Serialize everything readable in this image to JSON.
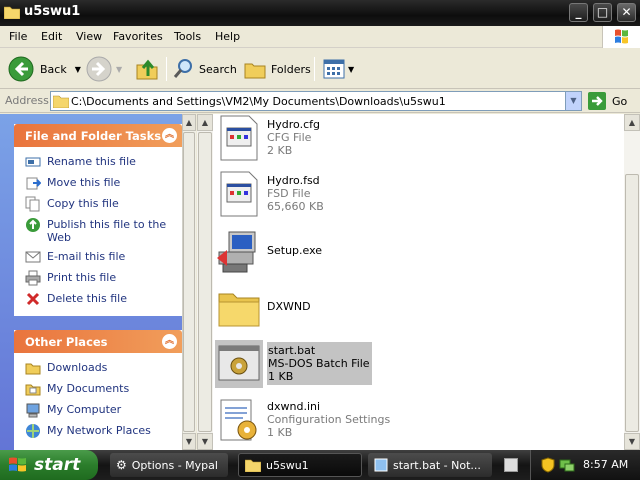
{
  "window": {
    "title": "u5swu1",
    "controls": {
      "minimize": "_",
      "maximize": "□",
      "close": "✕"
    }
  },
  "menu": [
    "File",
    "Edit",
    "View",
    "Favorites",
    "Tools",
    "Help"
  ],
  "toolbar": {
    "back": "Back",
    "search": "Search",
    "folders": "Folders"
  },
  "address": {
    "label": "Address",
    "path": "C:\\Documents and Settings\\VM2\\My Documents\\Downloads\\u5swu1",
    "go": "Go"
  },
  "left": {
    "file_tasks": {
      "title": "File and Folder Tasks",
      "items": [
        "Rename this file",
        "Move this file",
        "Copy this file",
        "Publish this file to the Web",
        "E-mail this file",
        "Print this file",
        "Delete this file"
      ]
    },
    "other_places": {
      "title": "Other Places",
      "items": [
        "Downloads",
        "My Documents",
        "My Computer",
        "My Network Places"
      ]
    }
  },
  "files": [
    {
      "name": "Hydro.cfg",
      "type": "CFG File",
      "size": "2 KB",
      "icon": "cfg-file-icon"
    },
    {
      "name": "Hydro.fsd",
      "type": "FSD File",
      "size": "65,660 KB",
      "icon": "fsd-file-icon"
    },
    {
      "name": "Setup.exe",
      "type": "",
      "size": "",
      "icon": "setup-icon"
    },
    {
      "name": "DXWND",
      "type": "",
      "size": "",
      "icon": "folder-icon"
    },
    {
      "name": "start.bat",
      "type": "MS-DOS Batch File",
      "size": "1 KB",
      "icon": "batch-file-icon",
      "selected": true
    },
    {
      "name": "dxwnd.ini",
      "type": "Configuration Settings",
      "size": "1 KB",
      "icon": "ini-file-icon"
    }
  ],
  "taskbar": {
    "start": "start",
    "buttons": [
      "Options - Mypal",
      "u5swu1",
      "start.bat - Not..."
    ],
    "clock": "8:57 AM"
  },
  "colors": {
    "task_link": "#21347f",
    "panel_header": "#e9743d",
    "selection": "#c3c3c3"
  }
}
